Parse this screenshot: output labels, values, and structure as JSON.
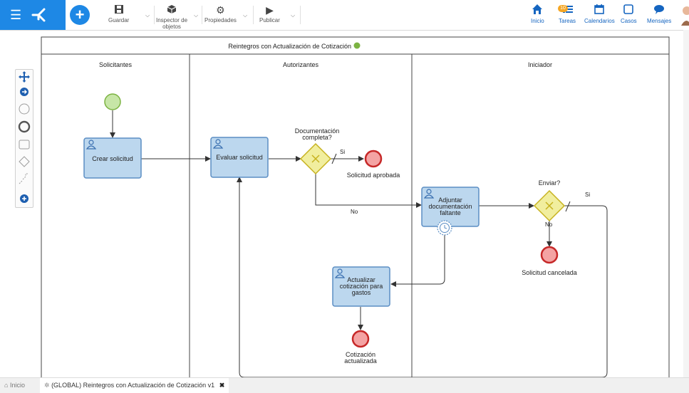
{
  "toolbar": {
    "save_label": "Guardar",
    "inspector_label_1": "Inspector de",
    "inspector_label_2": "objetos",
    "properties_label": "Propiedades",
    "publish_label": "Publicar"
  },
  "nav": {
    "home_label": "Inicio",
    "tasks_label": "Tareas",
    "tasks_badge": "10",
    "calendars_label": "Calendarios",
    "cases_label": "Casos",
    "messages_label": "Mensajes"
  },
  "pool": {
    "title": "Reintegros con Actualización de Cotización",
    "status_color": "#7cb342",
    "lanes": [
      "Solicitantes",
      "Autorizantes",
      "Iniciador"
    ]
  },
  "tasks": {
    "t1": "Crear solicitud",
    "t2": "Evaluar solicitud",
    "t3_1": "Adjuntar",
    "t3_2": "documentación",
    "t3_3": "faltante",
    "t4_1": "Actualizar",
    "t4_2": "cotización para",
    "t4_3": "gastos"
  },
  "gateways": {
    "g1_line1": "Documentación",
    "g1_line2": "completa?",
    "g1_yes": "Si",
    "g1_no": "No",
    "g2_title": "Enviar?",
    "g2_yes": "Si",
    "g2_no": "No"
  },
  "events": {
    "e1": "Solicitud aprobada",
    "e2": "Solicitud cancelada",
    "e3_1": "Cotización",
    "e3_2": "actualizada"
  },
  "status_bar": {
    "home_label": "Inicio",
    "tab_label": "(GLOBAL) Reintegros con Actualización de Cotización v1"
  },
  "colors": {
    "accent": "#1e88e5",
    "task_fill": "#bcd7ee",
    "task_stroke": "#5b8ec4",
    "gateway_fill": "#f1ee9e",
    "gateway_stroke": "#c7b21f",
    "start_fill": "#c7e6a7",
    "end_fill": "#f4a3a3"
  }
}
